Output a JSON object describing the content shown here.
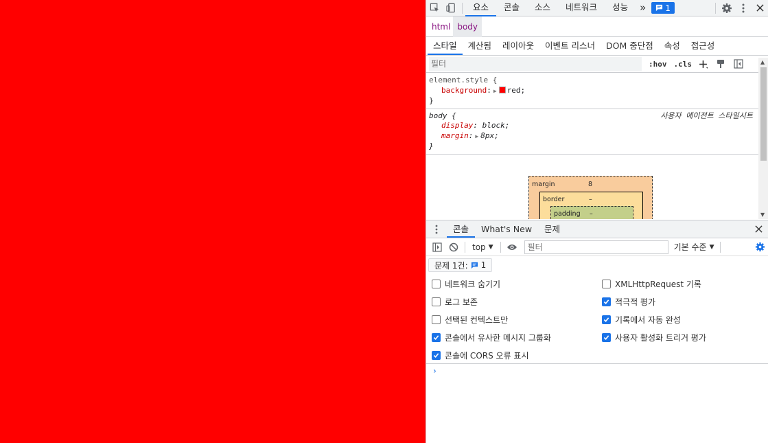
{
  "page": {
    "background_color": "#ff0000"
  },
  "devtools": {
    "toolbar": {
      "tabs": [
        "요소",
        "콘솔",
        "소스",
        "네트워크",
        "성능"
      ],
      "more": "»",
      "issues_count": "1"
    },
    "breadcrumb": {
      "items": [
        "html",
        "body"
      ]
    },
    "subtabs": [
      "스타일",
      "계산됨",
      "레이아웃",
      "이벤트 리스너",
      "DOM 중단점",
      "속성",
      "접근성"
    ],
    "styles": {
      "filter_placeholder": "필터",
      "hov": ":hov",
      "cls": ".cls",
      "rules": [
        {
          "selector": "element.style {",
          "decls": [
            {
              "prop": "background",
              "value": "red;",
              "swatch": "#ff0000"
            }
          ],
          "close": "}"
        },
        {
          "selector": "body {",
          "origin": "사용자 에이전트 스타일시트",
          "decls": [
            {
              "prop": "display",
              "value": "block;"
            },
            {
              "prop": "margin",
              "value": "8px;"
            }
          ],
          "close": "}"
        }
      ]
    },
    "box_model": {
      "margin_label": "margin",
      "margin_value": "8",
      "border_label": "border",
      "border_value": "–",
      "padding_label": "padding",
      "padding_value": "–"
    },
    "drawer": {
      "tabs": [
        "콘솔",
        "What's New",
        "문제"
      ],
      "context": "top",
      "filter_placeholder": "필터",
      "levels": "기본 수준",
      "issues_label": "문제 1건:",
      "issues_count": "1",
      "settings": [
        {
          "label": "네트워크 숨기기",
          "checked": false
        },
        {
          "label": "로그 보존",
          "checked": false
        },
        {
          "label": "선택된 컨텍스트만",
          "checked": false
        },
        {
          "label": "콘솔에서 유사한 메시지 그룹화",
          "checked": true
        },
        {
          "label": "콘솔에 CORS 오류 표시",
          "checked": true
        },
        {
          "label": "XMLHttpRequest 기록",
          "checked": false
        },
        {
          "label": "적극적 평가",
          "checked": true
        },
        {
          "label": "기록에서 자동 완성",
          "checked": true
        },
        {
          "label": "사용자 활성화 트리거 평가",
          "checked": true
        }
      ],
      "prompt": "›"
    },
    "colors": {
      "accent": "#1a73e8",
      "property": "#c80000",
      "tag": "#881280"
    }
  }
}
